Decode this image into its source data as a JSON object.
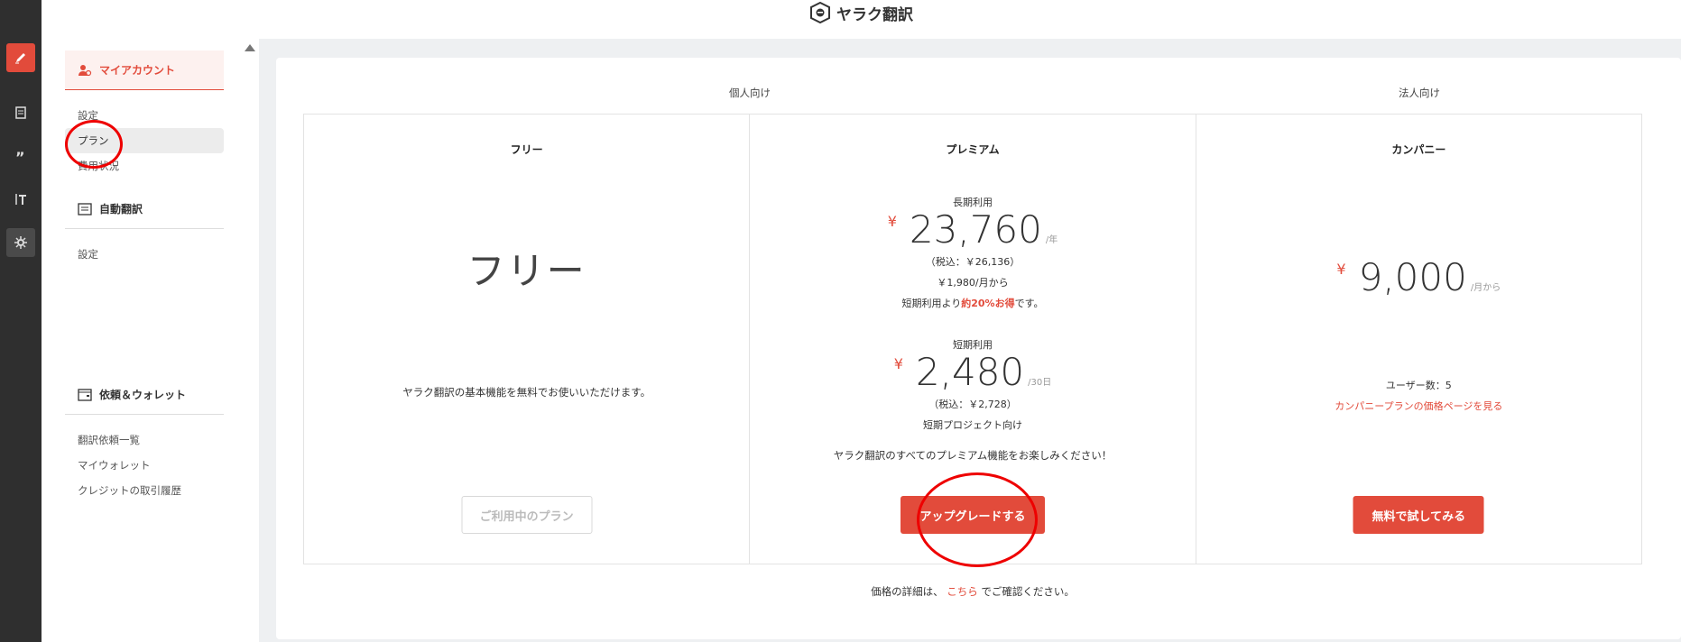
{
  "header": {
    "logo_text": "ヤラク翻訳"
  },
  "sidebar": {
    "sections": [
      {
        "title": "マイアカウント",
        "items": [
          "設定",
          "プラン",
          "費用状況"
        ]
      },
      {
        "title": "自動翻訳",
        "items": [
          "設定"
        ]
      },
      {
        "title": "依頼＆ウォレット",
        "items": [
          "翻訳依頼一覧",
          "マイウォレット",
          "クレジットの取引履歴"
        ]
      }
    ]
  },
  "groups": {
    "individual": "個人向け",
    "corporate": "法人向け"
  },
  "plans": {
    "free": {
      "title": "フリー",
      "big_label": "フリー",
      "description": "ヤラク翻訳の基本機能を無料でお使いいただけます。",
      "button": "ご利用中のプラン"
    },
    "premium": {
      "title": "プレミアム",
      "long_label": "長期利用",
      "long_currency": "¥",
      "long_price": "23,760",
      "long_unit": "/年",
      "long_tax": "（税込：￥26,136）",
      "long_monthly": "￥1,980/月から",
      "long_savings_pre": "短期利用より",
      "long_savings_hl": "約20%お得",
      "long_savings_post": "です。",
      "short_label": "短期利用",
      "short_currency": "¥",
      "short_price": "2,480",
      "short_unit": "/30日",
      "short_tax": "（税込：￥2,728）",
      "short_note": "短期プロジェクト向け",
      "description": "ヤラク翻訳のすべてのプレミアム機能をお楽しみください！",
      "button": "アップグレードする"
    },
    "company": {
      "title": "カンパニー",
      "currency": "¥",
      "price": "9,000",
      "unit": "/月から",
      "users": "ユーザー数：5",
      "link": "カンパニープランの価格ページを見る",
      "button": "無料で試してみる"
    }
  },
  "footer": {
    "pre": "価格の詳細は、",
    "link": "こちら",
    "post": "でご確認ください。"
  },
  "colors": {
    "accent": "#e24b3b",
    "rail": "#2f2f2f"
  }
}
